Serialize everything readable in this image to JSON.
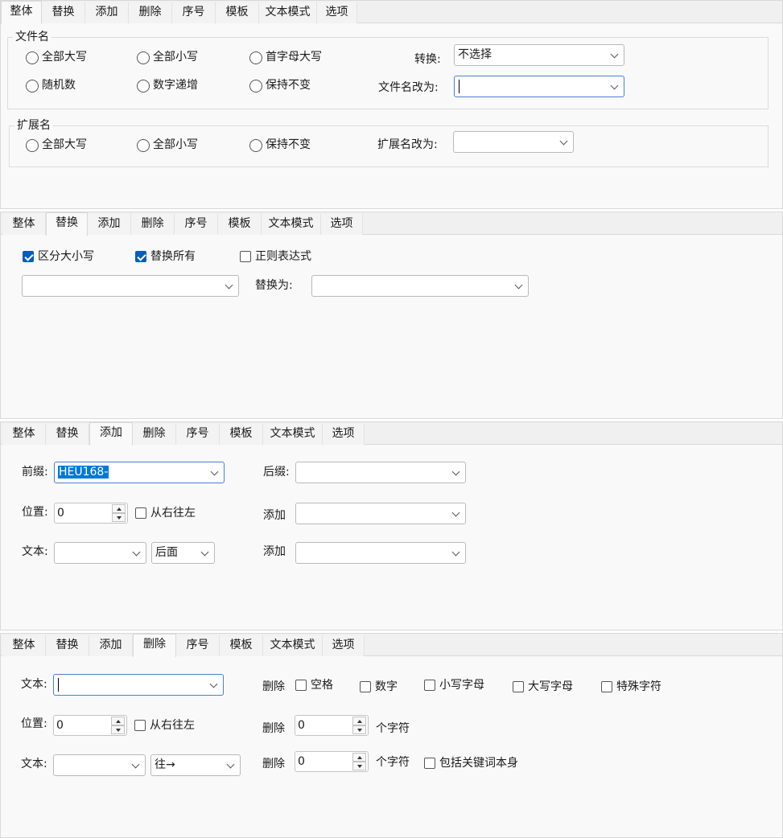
{
  "tabs": [
    "整体",
    "替换",
    "添加",
    "删除",
    "序号",
    "模板",
    "文本模式",
    "选项"
  ],
  "panel_overall": {
    "filename_group": {
      "title": "文件名",
      "options": [
        "全部大写",
        "全部小写",
        "首字母大写",
        "随机数",
        "数字递增",
        "保持不变"
      ],
      "convert_label": "转换:",
      "convert_value": "不选择",
      "rename_label": "文件名改为:",
      "rename_value": ""
    },
    "ext_group": {
      "title": "扩展名",
      "options": [
        "全部大写",
        "全部小写",
        "保持不变"
      ],
      "rename_label": "扩展名改为:",
      "rename_value": ""
    }
  },
  "panel_replace": {
    "case_sensitive": "区分大小写",
    "replace_all": "替换所有",
    "regex": "正则表达式",
    "find_value": "",
    "replace_label": "替换为:",
    "replace_value": ""
  },
  "panel_add": {
    "prefix_label": "前缀:",
    "prefix_value": "HEU168-",
    "suffix_label": "后缀:",
    "suffix_value": "",
    "position_label": "位置:",
    "position_value": "0",
    "right_to_left": "从右往左",
    "add_label_1": "添加",
    "add_label_2": "添加",
    "text_label": "文本:",
    "text_value": "",
    "direction_value": "后面"
  },
  "panel_delete": {
    "text_label": "文本:",
    "text_value": "",
    "delete_label_1": "删除",
    "delete_label_2": "删除",
    "delete_label_3": "删除",
    "opt_space": "空格",
    "opt_digits": "数字",
    "opt_lower": "小写字母",
    "opt_upper": "大写字母",
    "opt_special": "特殊字符",
    "position_label": "位置:",
    "position_value": "0",
    "right_to_left": "从右往左",
    "count_value_1": "0",
    "count_value_2": "0",
    "chars_unit_1": "个字符",
    "chars_unit_2": "个字符",
    "text_label_2": "文本:",
    "text_value_2": "",
    "direction_value": "往→",
    "include_keyword": "包括关键词本身"
  }
}
